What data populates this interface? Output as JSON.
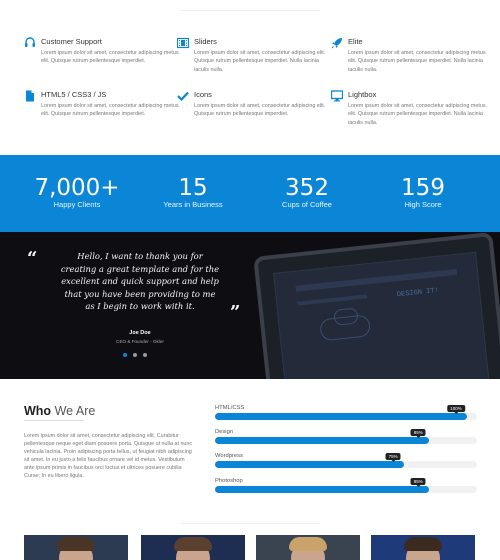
{
  "features": [
    {
      "icon": "headset-icon",
      "title": "Customer Support",
      "text": "Lorem ipsum dolor sit amet, consectetur adipiscing metus. elit. Quisque rutrum pellentesque imperdiet."
    },
    {
      "icon": "film-icon",
      "title": "Sliders",
      "text": "Lorem ipsum dolor sit amet, consectetur adipiscing elit. Quisque rutrum pellentesque imperdiet. Nulla lacinia iaculis nulla."
    },
    {
      "icon": "rocket-icon",
      "title": "Elite",
      "text": "Lorem ipsum dolor sit amet, consectetur adipiscing metus. elit. Quisque rutrum pellentesque imperdiet. Nulla lacinia iaculis nulla."
    },
    {
      "icon": "document-icon",
      "title": "HTML5 / CSS3 / JS",
      "text": "Lorem ipsum dolor sit amet, consectetur adipiscing metus. elit. Quisque rutrum pellentesque imperdiet."
    },
    {
      "icon": "check-icon",
      "title": "Icons",
      "text": "Lorem ipsum dolor sit amet, consectetur adipiscing elit. Quisque rutrum pellentesque imperdiet."
    },
    {
      "icon": "monitor-icon",
      "title": "Lightbox",
      "text": "Lorem ipsum dolor sit amet, consectetur adipiscing metus. elit. Quisque rutrum pellentesque imperdiet. Nulla lacinia iaculis nulla."
    }
  ],
  "stats": [
    {
      "value": "7,000+",
      "label": "Happy Clients"
    },
    {
      "value": "15",
      "label": "Years in Business"
    },
    {
      "value": "352",
      "label": "Cups of Coffee"
    },
    {
      "value": "159",
      "label": "High Score"
    }
  ],
  "testimonial": {
    "open_quote": "“",
    "close_quote": "”",
    "quote": "Hello, I want to thank you for creating a great template and for the excellent and quick support and help that you have been providing to me as I begin to work with it.",
    "author": "Joe Doe",
    "role": "CEO & Founder - Okler",
    "screen_text": "DESIGN IT!",
    "slides": 3,
    "active_slide": 1
  },
  "who": {
    "title_bold": "Who",
    "title_rest": "We Are",
    "text": "Lorem ipsum dolor sit amet, consectetur adipiscing elit. Curabitur pellentesque neque eget diam posuere porta. Quisque ut nulla at nunc vehicula lacinia. Proin adipiscing porta tellus, ut feugiat nibh adipiscing sit amet. In eu justo a felis faucibus ornare vel id metus. Vestibulum ante ipsum primis in faucibus orci luctus et ultrices posuere cubilia Curae; In eu libero ligula."
  },
  "skills": [
    {
      "name": "HTML/CSS",
      "percent": 100,
      "label": "100%"
    },
    {
      "name": "Design",
      "percent": 85,
      "label": "85%"
    },
    {
      "name": "Wordpress",
      "percent": 75,
      "label": "75%"
    },
    {
      "name": "Photoshop",
      "percent": 85,
      "label": "85%"
    }
  ],
  "colors": {
    "accent": "#0b86d6",
    "dark": "#0e0e12"
  },
  "team_photos": [
    {
      "bg": "#2d3b52",
      "hair": "#4a3426"
    },
    {
      "bg": "#1d2e52",
      "hair": "#5b4030"
    },
    {
      "bg": "#3a4450",
      "hair": "#c9a36a"
    },
    {
      "bg": "#1e3a78",
      "hair": "#3a2a20"
    }
  ]
}
